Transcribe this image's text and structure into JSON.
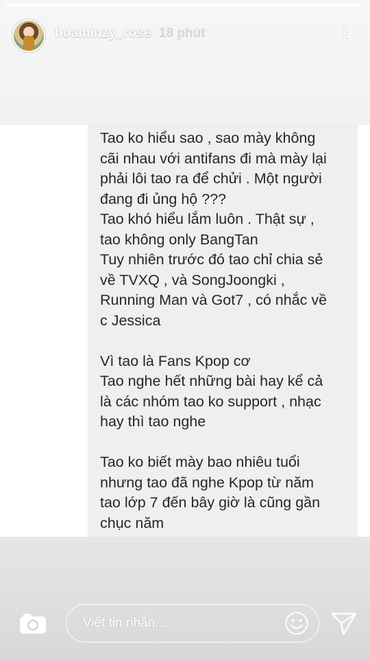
{
  "story": {
    "progress_fraction": 0.98
  },
  "header": {
    "username": "hoaminzy_rose",
    "timestamp": "18 phút"
  },
  "message": {
    "text": "Tao ko hiểu sao , sao mày không\ncãi nhau với antifans đi mà mày lại\nphải lôi tao ra để chửi . Một người\nđang đi ủng hộ ???\nTao khó hiểu lắm luôn . Thật sự ,\ntao không only BangTan\nTuy nhiên trước đó tao chỉ chia sẻ\nvề TVXQ , và SongJoongki ,\nRunning Man và Got7 , có nhắc về\nc Jessica\n\nVì tao là Fans Kpop cơ\nTao nghe hết những bài hay kể cả\nlà các nhóm tao ko support , nhạc\nhay thì tao nghe\n\nTao ko biết mày bao nhiêu tuổi\nnhưng tao đã nghe Kpop từ năm\ntao lớp 7 đến bây giờ là cũng gần\nchục năm"
  },
  "composer": {
    "placeholder": "Viết tin nhắn..."
  },
  "icons": {
    "camera": "camera-icon",
    "smiley": "smiley-icon",
    "send": "send-icon",
    "more": "more-options-icon"
  },
  "colors": {
    "bubble_bg": "#efefef",
    "text": "#262626",
    "overlay_text": "#ffffff"
  }
}
